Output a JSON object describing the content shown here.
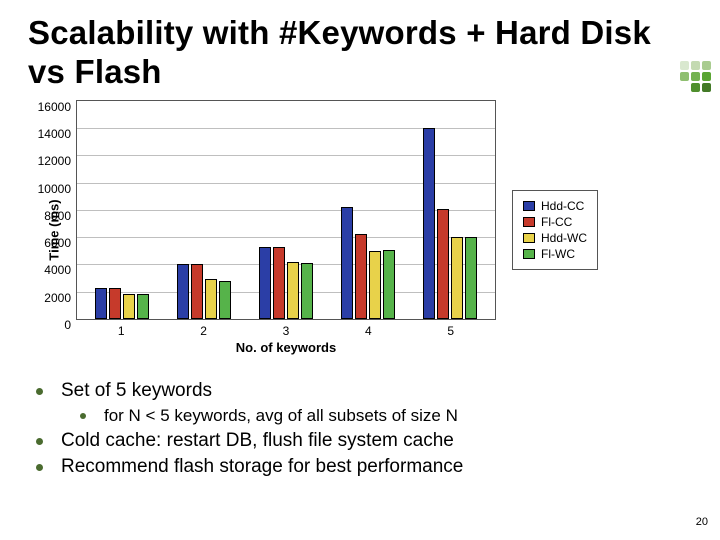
{
  "title": "Scalability with #Keywords + Hard Disk vs Flash",
  "page_number": "20",
  "chart_data": {
    "type": "bar",
    "title": "",
    "xlabel": "No. of keywords",
    "ylabel": "Time (ms)",
    "ylim": [
      0,
      16000
    ],
    "yticks": [
      0,
      2000,
      4000,
      6000,
      8000,
      10000,
      12000,
      14000,
      16000
    ],
    "categories": [
      "1",
      "2",
      "3",
      "4",
      "5"
    ],
    "series": [
      {
        "name": "Hdd-CC",
        "color": "#2b3ea6",
        "values": [
          2300,
          4000,
          5300,
          8200,
          14000
        ]
      },
      {
        "name": "Fl-CC",
        "color": "#c63a2b",
        "values": [
          2300,
          4000,
          5300,
          6200,
          8100
        ]
      },
      {
        "name": "Hdd-WC",
        "color": "#e8d24a",
        "values": [
          1800,
          2900,
          4200,
          5000,
          6000
        ]
      },
      {
        "name": "Fl-WC",
        "color": "#56b34a",
        "values": [
          1800,
          2800,
          4100,
          5050,
          6000
        ]
      }
    ]
  },
  "bullets": {
    "b1": "Set of 5 keywords",
    "b1a": "for N < 5 keywords, avg of all subsets of size N",
    "b2": "Cold cache: restart DB, flush file system cache",
    "b3": "Recommend flash storage for best performance"
  },
  "deco_colors": [
    "#d9e8cf",
    "#c4dab2",
    "#a9cc90",
    "#8fbf70",
    "#74b251",
    "#5aa533",
    "#4f8f2d",
    "#437a27"
  ]
}
